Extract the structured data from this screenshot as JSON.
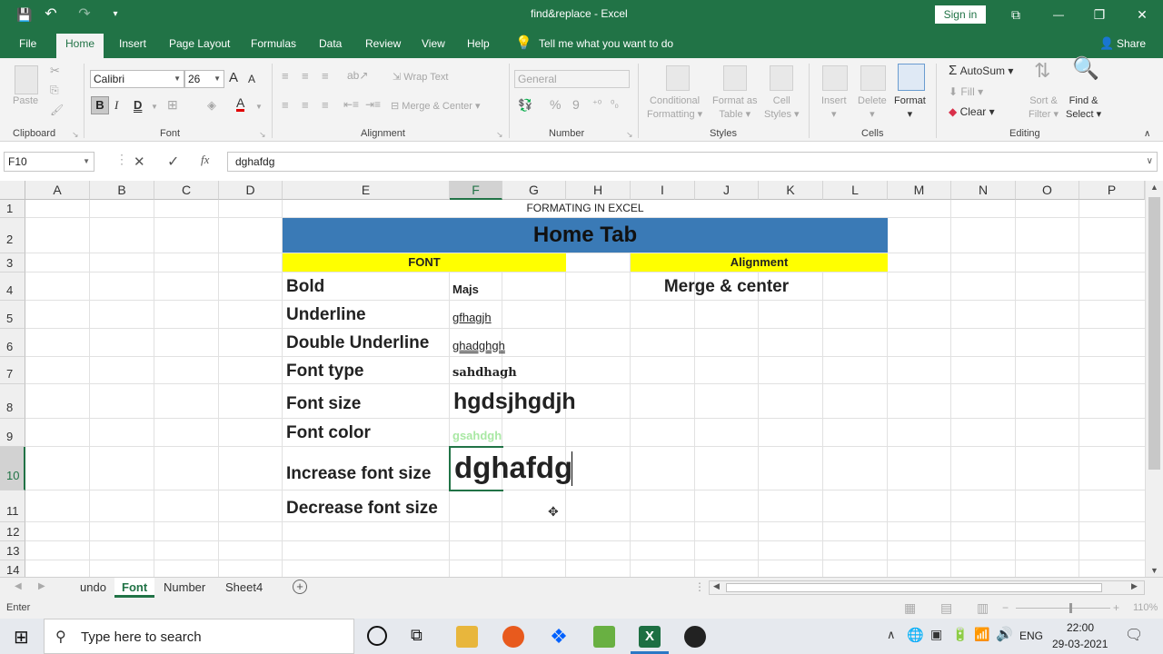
{
  "titlebar": {
    "title": "find&replace  -  Excel",
    "signin": "Sign in",
    "qat_save": "💾",
    "qat_undo": "↶",
    "qat_redo": "↷",
    "qat_more": "▾",
    "restore_icon": "⧉",
    "min_icon": "—",
    "max_icon": "❐",
    "close_icon": "✕"
  },
  "ribbon_tabs": [
    "File",
    "Home",
    "Insert",
    "Page Layout",
    "Formulas",
    "Data",
    "Review",
    "View",
    "Help"
  ],
  "tell_me": "Tell me what you want to do",
  "share": "Share",
  "ribbon": {
    "clipboard": {
      "paste": "Paste",
      "label": "Clipboard"
    },
    "font": {
      "name": "Calibri",
      "size": "26",
      "bold": "B",
      "italic": "I",
      "underline": "D",
      "grow": "A",
      "shrink": "A",
      "label": "Font"
    },
    "alignment": {
      "wrap": "Wrap Text",
      "merge": "Merge & Center",
      "label": "Alignment"
    },
    "number": {
      "format": "General",
      "percent": "%",
      "comma": "9",
      "label": "Number"
    },
    "styles": {
      "cond": "Conditional",
      "cond2": "Formatting",
      "fmt_table": "Format as",
      "fmt_table2": "Table",
      "cell_styles": "Cell",
      "cell_styles2": "Styles",
      "label": "Styles"
    },
    "cells": {
      "insert": "Insert",
      "delete": "Delete",
      "format": "Format",
      "label": "Cells"
    },
    "editing": {
      "autosum": "AutoSum",
      "fill": "Fill",
      "clear": "Clear",
      "sort": "Sort &",
      "sort2": "Filter",
      "find": "Find &",
      "find2": "Select",
      "label": "Editing"
    }
  },
  "formula_bar": {
    "name_box": "F10",
    "cancel": "✕",
    "enter": "✓",
    "fx": "fx",
    "value": "dghafdg"
  },
  "columns": [
    "A",
    "B",
    "C",
    "D",
    "E",
    "F",
    "G",
    "H",
    "I",
    "J",
    "K",
    "L",
    "M",
    "N",
    "O",
    "P"
  ],
  "rows": [
    "1",
    "2",
    "3",
    "4",
    "5",
    "6",
    "7",
    "8",
    "9",
    "10",
    "11",
    "12",
    "13",
    "14"
  ],
  "cells": {
    "r1": "FORMATING IN EXCEL",
    "r2": "Home Tab",
    "font_hdr": "FONT",
    "align_hdr": "Alignment",
    "bold": "Bold",
    "bold_v": "Majs",
    "merge": "Merge & center",
    "underline": "Underline",
    "underline_v": "gfhagjh",
    "dbl": "Double Underline",
    "dbl_v": "ghadghgh",
    "ftype": "Font type",
    "ftype_v": "sahdhagh",
    "fsize": "Font size",
    "fsize_v": "hgdsjhgdjh",
    "fcolor": "Font color",
    "fcolor_v": "gsahdgh",
    "inc": "Increase font size",
    "inc_v": "dghafdg",
    "dec": "Decrease font size"
  },
  "sheets": [
    "undo",
    "Font",
    "Number",
    "Sheet4"
  ],
  "status": {
    "mode": "Enter",
    "zoom": "110%"
  },
  "taskbar": {
    "search": "Type here to search",
    "lang": "ENG",
    "time": "22:00",
    "date": "29-03-2021"
  },
  "colors": {
    "excel_green": "#217346",
    "blue_band": "#3a7ab6",
    "yellow": "#ffff00",
    "light_green_text": "#a9e8a4"
  }
}
